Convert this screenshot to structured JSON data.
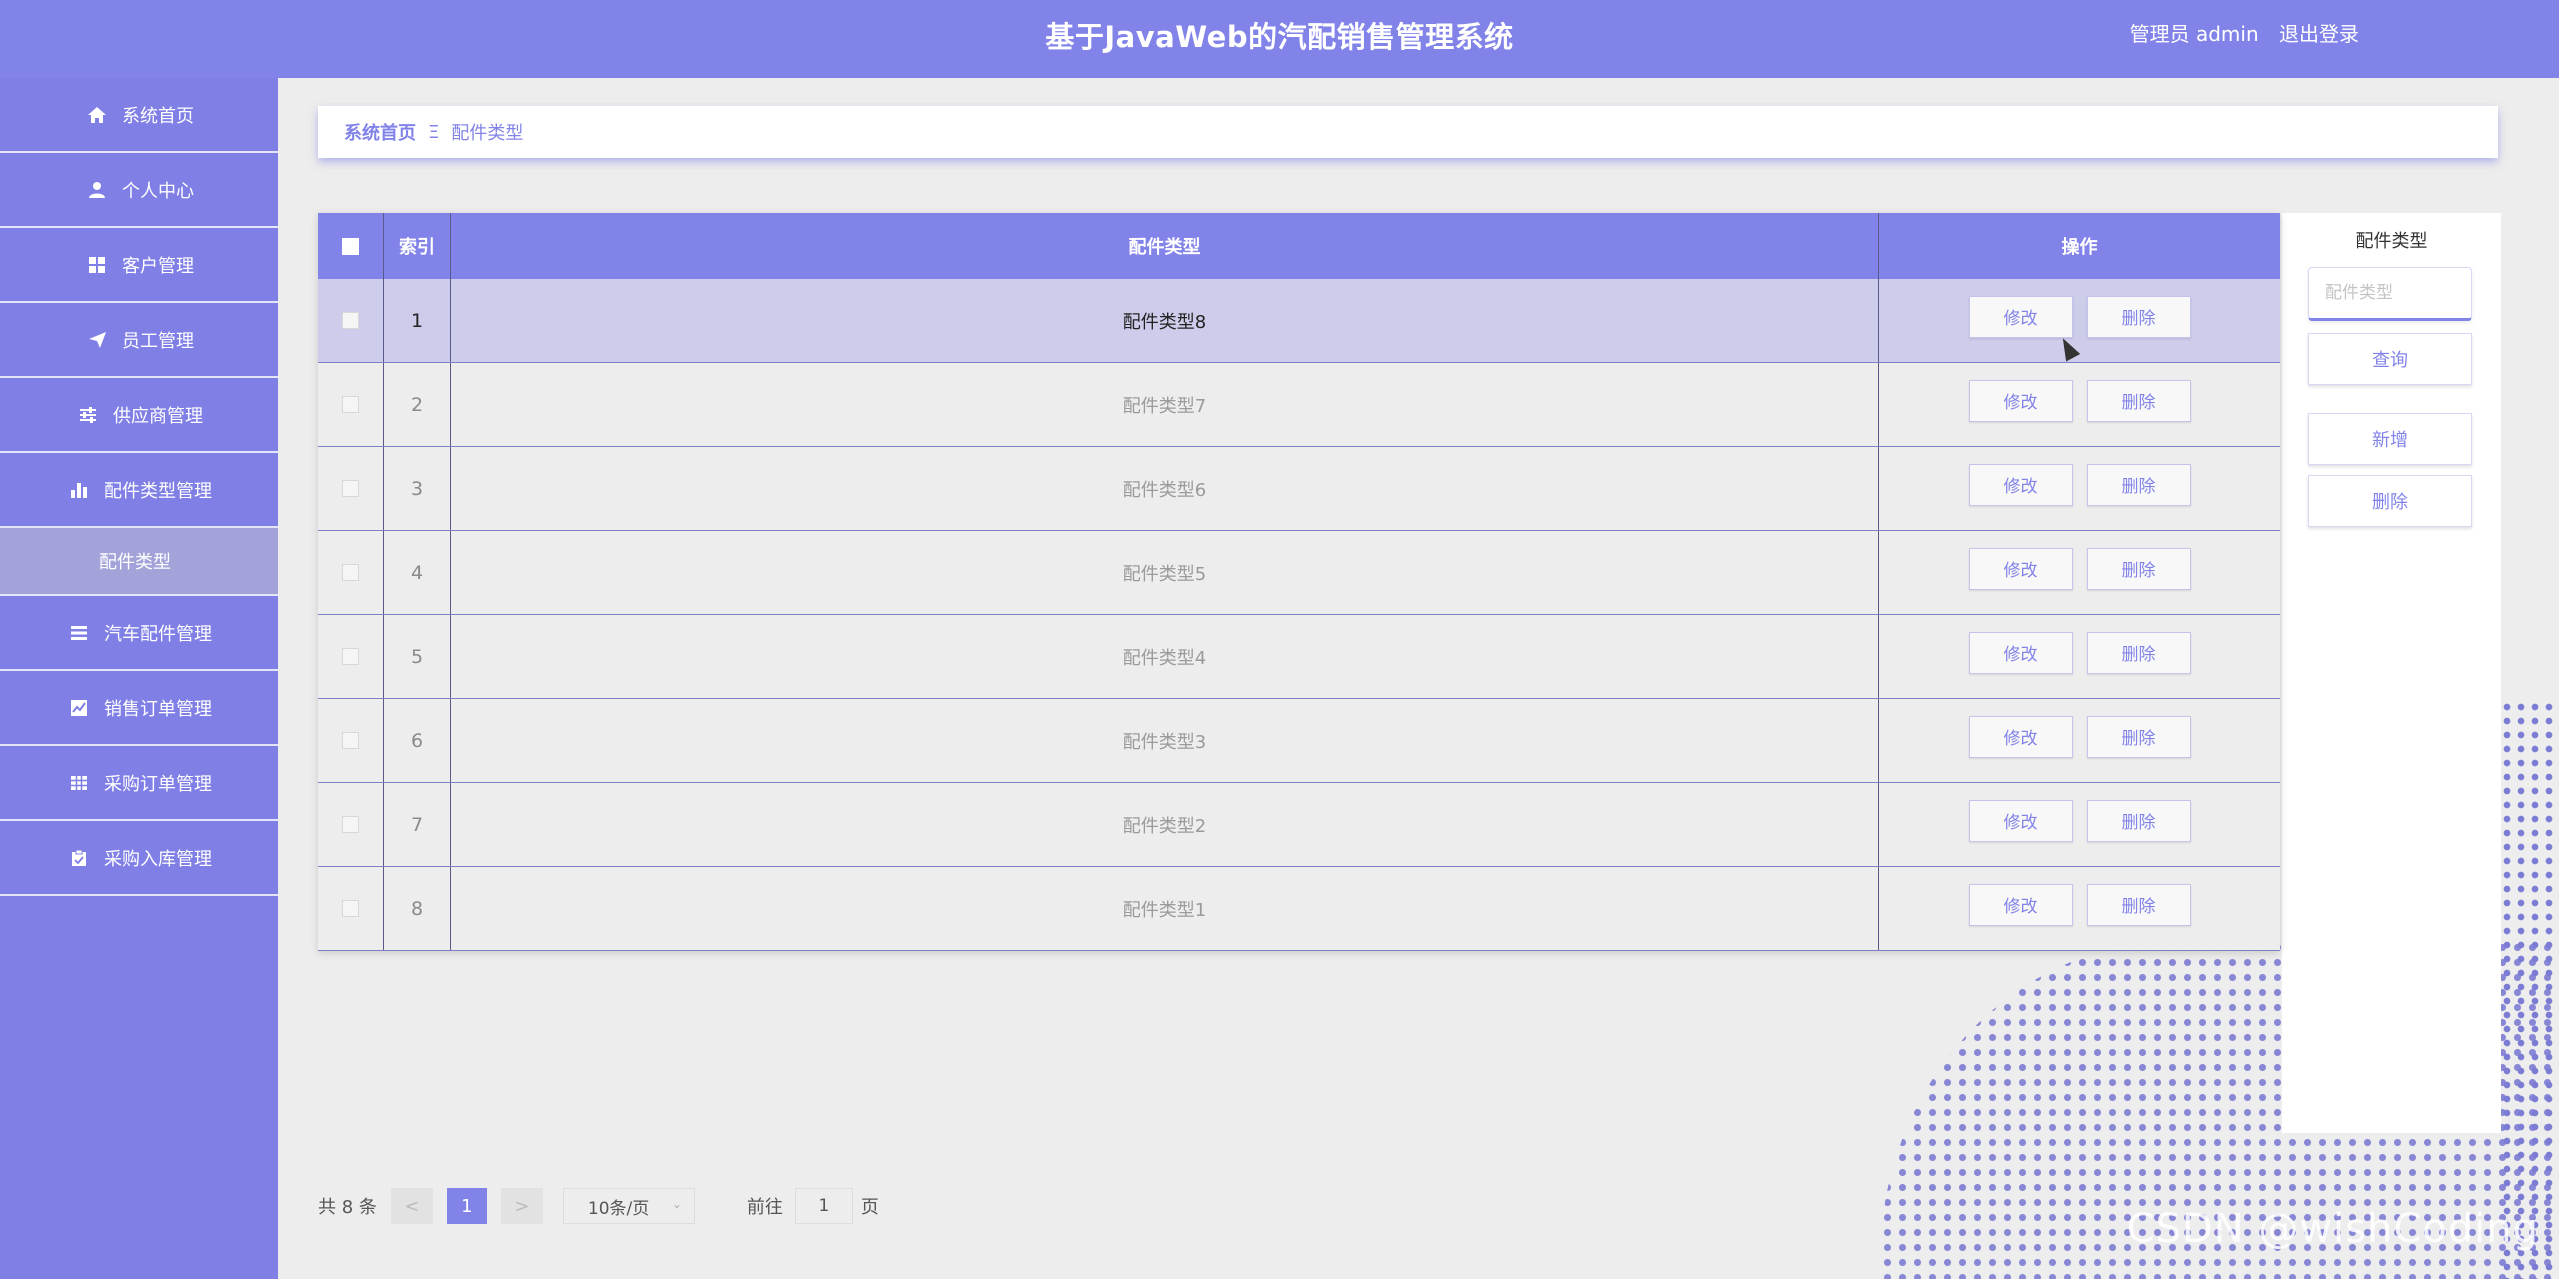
{
  "header": {
    "title": "基于JavaWeb的汽配销售管理系统",
    "user_label": "管理员 admin",
    "logout": "退出登录"
  },
  "sidebar": {
    "items": [
      {
        "label": "系统首页",
        "icon": "home-icon"
      },
      {
        "label": "个人中心",
        "icon": "user-icon"
      },
      {
        "label": "客户管理",
        "icon": "grid-icon"
      },
      {
        "label": "员工管理",
        "icon": "send-icon"
      },
      {
        "label": "供应商管理",
        "icon": "sliders-icon"
      },
      {
        "label": "配件类型管理",
        "icon": "bar-chart-icon"
      },
      {
        "label": "配件类型",
        "icon": ""
      },
      {
        "label": "汽车配件管理",
        "icon": "list-icon"
      },
      {
        "label": "销售订单管理",
        "icon": "chart-box-icon"
      },
      {
        "label": "采购订单管理",
        "icon": "table-icon"
      },
      {
        "label": "采购入库管理",
        "icon": "clipboard-icon"
      }
    ]
  },
  "breadcrumb": {
    "home": "系统首页",
    "separator": "Ξ",
    "current": "配件类型"
  },
  "table": {
    "headers": {
      "index": "索引",
      "name": "配件类型",
      "ops": "操作"
    },
    "edit_label": "修改",
    "delete_label": "删除",
    "rows": [
      {
        "index": "1",
        "name": "配件类型8"
      },
      {
        "index": "2",
        "name": "配件类型7"
      },
      {
        "index": "3",
        "name": "配件类型6"
      },
      {
        "index": "4",
        "name": "配件类型5"
      },
      {
        "index": "5",
        "name": "配件类型4"
      },
      {
        "index": "6",
        "name": "配件类型3"
      },
      {
        "index": "7",
        "name": "配件类型2"
      },
      {
        "index": "8",
        "name": "配件类型1"
      }
    ]
  },
  "search_panel": {
    "title": "配件类型",
    "placeholder": "配件类型",
    "query": "查询",
    "add": "新增",
    "delete": "删除"
  },
  "pagination": {
    "total": "共 8 条",
    "prev": "<",
    "current_page": "1",
    "next": ">",
    "page_size": "10条/页",
    "goto_label": "前往",
    "goto_value": "1",
    "page_suffix": "页"
  },
  "watermark": "CSDN @wishCoding",
  "colors": {
    "accent": "#8283e8",
    "sidebar": "#7f7fe6",
    "highlight_row": "#cdcdeb"
  }
}
